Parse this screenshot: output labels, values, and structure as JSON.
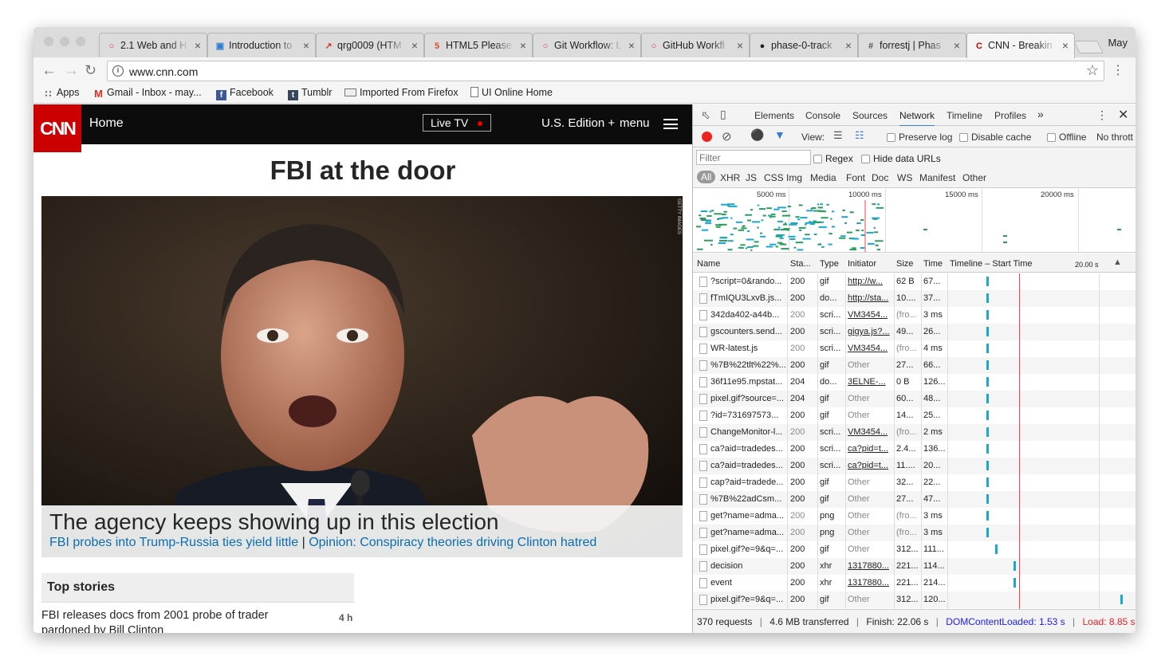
{
  "browser": {
    "tabs": [
      {
        "label": "2.1 Web and H",
        "icon": "opera-icon",
        "color": "#e0312c"
      },
      {
        "label": "Introduction to",
        "icon": "circle-doc-icon",
        "color": "#2a7fd4"
      },
      {
        "label": "qrg0009 (HTM",
        "icon": "pdf-icon",
        "color": "#d8321e"
      },
      {
        "label": "HTML5 Please",
        "icon": "html5-icon",
        "color": "#e34c26"
      },
      {
        "label": "Git Workflow: L",
        "icon": "opera-icon",
        "color": "#e0312c"
      },
      {
        "label": "GitHub Workfl",
        "icon": "opera-icon",
        "color": "#e0312c"
      },
      {
        "label": "phase-0-track",
        "icon": "github-icon",
        "color": "#222222"
      },
      {
        "label": "forrestj | Phas",
        "icon": "hash-icon",
        "color": "#555555"
      },
      {
        "label": "CNN - Breakin",
        "icon": "cnn-icon",
        "color": "#cc0000"
      }
    ],
    "profile": "May",
    "url": "www.cnn.com",
    "bookmarks": [
      "Apps",
      "Gmail - Inbox - may...",
      "Facebook",
      "Tumblr",
      "Imported From Firefox",
      "UI Online Home"
    ]
  },
  "cnn": {
    "logo": "CNN",
    "home": "Home",
    "live_tv": "Live TV",
    "edition": "U.S. Edition +",
    "menu": "menu",
    "headline": "FBI at the door",
    "photo_credit": "GETTY IMAGES",
    "caption": "The agency keeps showing up in this election",
    "link1": "FBI probes into Trump-Russia ties yield little",
    "separator": "|",
    "link2": "Opinion: Conspiracy theories driving Clinton hatred",
    "top_stories": "Top stories",
    "story": "FBI releases docs from 2001 probe of trader pardoned by Bill Clinton",
    "story_age": "4 h"
  },
  "devtools": {
    "tabs": [
      "Elements",
      "Console",
      "Sources",
      "Network",
      "Timeline",
      "Profiles"
    ],
    "active_tab": "Network",
    "more": "»",
    "view_label": "View:",
    "preserve_log": "Preserve log",
    "disable_cache": "Disable cache",
    "offline": "Offline",
    "throttle": "No thrott",
    "filter_placeholder": "Filter",
    "regex": "Regex",
    "hide_data_urls": "Hide data URLs",
    "types": [
      "All",
      "XHR",
      "JS",
      "CSS",
      "Img",
      "Media",
      "Font",
      "Doc",
      "WS",
      "Manifest",
      "Other"
    ],
    "overview_ticks": [
      "5000 ms",
      "10000 ms",
      "15000 ms",
      "20000 ms"
    ],
    "columns": [
      "Name",
      "Sta...",
      "Type",
      "Initiator",
      "Size",
      "Time",
      "Timeline – Start Time",
      "20.00 s"
    ],
    "rows": [
      {
        "name": "?script=0&rando...",
        "status": "200",
        "type": "gif",
        "initiator": "http://w...",
        "size": "62 B",
        "time": "67...",
        "start": 0.21
      },
      {
        "name": "fTmIQU3LxvB.js...",
        "status": "200",
        "type": "do...",
        "initiator": "http://sta...",
        "size": "10....",
        "time": "37...",
        "start": 0.21
      },
      {
        "name": "342da402-a44b...",
        "status": "200",
        "type": "scri...",
        "initiator": "VM3454...",
        "size": "(fro...",
        "time": "3 ms",
        "start": 0.21
      },
      {
        "name": "gscounters.send...",
        "status": "200",
        "type": "scri...",
        "initiator": "gigya.js?...",
        "size": "49...",
        "time": "26...",
        "start": 0.21
      },
      {
        "name": "WR-latest.js",
        "status": "200",
        "type": "scri...",
        "initiator": "VM3454...",
        "size": "(fro...",
        "time": "4 ms",
        "start": 0.21
      },
      {
        "name": "%7B%22tlt%22%...",
        "status": "200",
        "type": "gif",
        "initiator": "Other",
        "size": "27...",
        "time": "66...",
        "start": 0.21
      },
      {
        "name": "36f11e95.mpstat...",
        "status": "204",
        "type": "do...",
        "initiator": "3ELNE-...",
        "size": "0 B",
        "time": "126...",
        "start": 0.21
      },
      {
        "name": "pixel.gif?source=...",
        "status": "204",
        "type": "gif",
        "initiator": "Other",
        "size": "60...",
        "time": "48...",
        "start": 0.21
      },
      {
        "name": "?id=731697573...",
        "status": "200",
        "type": "gif",
        "initiator": "Other",
        "size": "14...",
        "time": "25...",
        "start": 0.21
      },
      {
        "name": "ChangeMonitor-l...",
        "status": "200",
        "type": "scri...",
        "initiator": "VM3454...",
        "size": "(fro...",
        "time": "2 ms",
        "start": 0.21
      },
      {
        "name": "ca?aid=tradedes...",
        "status": "200",
        "type": "scri...",
        "initiator": "ca?pid=t...",
        "size": "2.4...",
        "time": "136...",
        "start": 0.21
      },
      {
        "name": "ca?aid=tradedes...",
        "status": "200",
        "type": "scri...",
        "initiator": "ca?pid=t...",
        "size": "11....",
        "time": "20...",
        "start": 0.21
      },
      {
        "name": "cap?aid=tradede...",
        "status": "200",
        "type": "gif",
        "initiator": "Other",
        "size": "32...",
        "time": "22...",
        "start": 0.21
      },
      {
        "name": "%7B%22adCsm...",
        "status": "200",
        "type": "gif",
        "initiator": "Other",
        "size": "27...",
        "time": "47...",
        "start": 0.21
      },
      {
        "name": "get?name=adma...",
        "status": "200",
        "type": "png",
        "initiator": "Other",
        "size": "(fro...",
        "time": "3 ms",
        "start": 0.21
      },
      {
        "name": "get?name=adma...",
        "status": "200",
        "type": "png",
        "initiator": "Other",
        "size": "(fro...",
        "time": "3 ms",
        "start": 0.21
      },
      {
        "name": "pixel.gif?e=9&q=...",
        "status": "200",
        "type": "gif",
        "initiator": "Other",
        "size": "312...",
        "time": "111...",
        "start": 0.26
      },
      {
        "name": "decision",
        "status": "200",
        "type": "xhr",
        "initiator": "1317880...",
        "size": "221...",
        "time": "114...",
        "start": 0.36
      },
      {
        "name": "event",
        "status": "200",
        "type": "xhr",
        "initiator": "1317880...",
        "size": "221...",
        "time": "214...",
        "start": 0.36
      },
      {
        "name": "pixel.gif?e=9&q=...",
        "status": "200",
        "type": "gif",
        "initiator": "Other",
        "size": "312...",
        "time": "120...",
        "start": 0.94
      }
    ],
    "status": {
      "requests": "370 requests",
      "transferred": "4.6 MB transferred",
      "finish": "Finish: 22.06 s",
      "dcl": "DOMContentLoaded: 1.53 s",
      "load": "Load: 8.85 s",
      "sep": "|",
      "dcl_color": "#1a1aff",
      "load_color": "#e22222"
    }
  }
}
